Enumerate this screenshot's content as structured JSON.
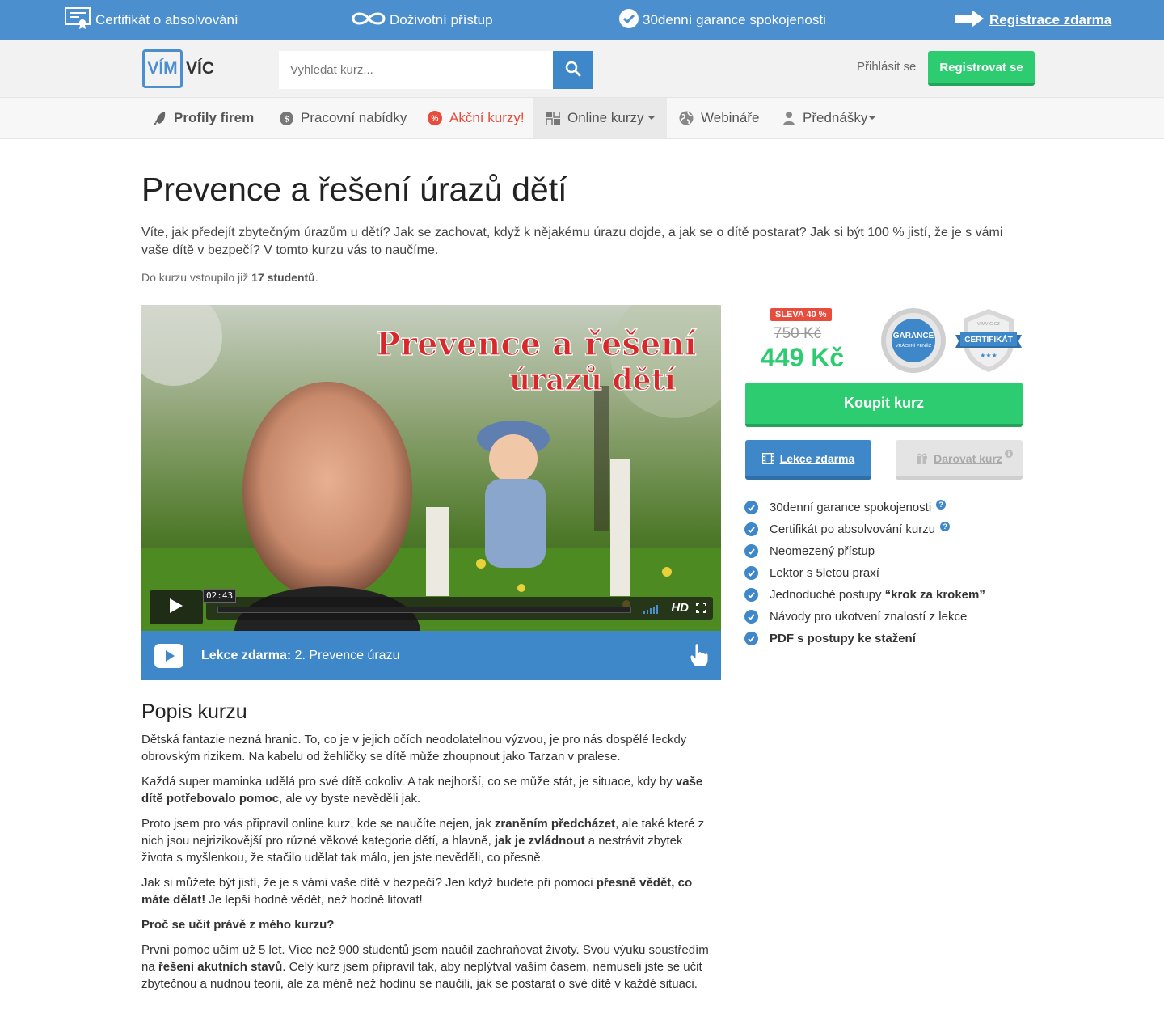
{
  "topbar": {
    "certificate": "Certifikát o absolvování",
    "lifetime": "Doživotní přístup",
    "guarantee": "30denní garance spokojenosti",
    "register": "Registrace zdarma"
  },
  "header": {
    "logo_left": "VÍM",
    "logo_right": "VÍC",
    "search_placeholder": "Vyhledat kurz...",
    "login": "Přihlásit se",
    "register": "Registrovat se"
  },
  "nav": {
    "items": [
      {
        "label": "Profily firem",
        "icon": "rocket-icon"
      },
      {
        "label": "Pracovní nabídky",
        "icon": "dollar-icon"
      },
      {
        "label": "Akční kurzy!",
        "icon": "percent-icon"
      },
      {
        "label": "Online kurzy",
        "icon": "grid-icon"
      },
      {
        "label": "Webináře",
        "icon": "globe-icon"
      },
      {
        "label": "Přednášky",
        "icon": "person-icon"
      }
    ]
  },
  "course": {
    "title": "Prevence a řešení úrazů dětí",
    "lead": "Víte, jak předejít zbytečným úrazům u dětí? Jak se zachovat, když k nějakému úrazu dojde, a jak se o dítě postarat? Jak si být 100 % jistí, že je s vámi vaše dítě v bezpečí? V tomto kurzu vás to naučíme.",
    "students_prefix": "Do kurzu vstoupilo již",
    "students_count": "17 studentů",
    "students_suffix": "."
  },
  "video": {
    "overlay_line1": "Prevence a řešení",
    "overlay_line2": "úrazů dětí",
    "timestamp": "02:43",
    "hd": "HD",
    "lesson_label": "Lekce zdarma:",
    "lesson_title": "2. Prevence úrazu"
  },
  "pricing": {
    "discount": "SLEVA 40 %",
    "old_price": "750 Kč",
    "new_price": "449 Kč",
    "badge_guarantee_line1": "GARANCE",
    "badge_guarantee_line2": "VRÁCENÍ PENĚZ",
    "badge_certificate": "CERTIFIKÁT",
    "badge_certificate_top": "VÍMVÍC.CZ",
    "buy": "Koupit kurz",
    "free_lesson": "Lekce zdarma",
    "gift": "Darovat kurz"
  },
  "features": [
    {
      "pre": "30denní garance spokojenosti",
      "bold": "",
      "help": true
    },
    {
      "pre": "Certifikát po absolvování kurzu",
      "bold": "",
      "help": true
    },
    {
      "pre": "Neomezený přístup",
      "bold": "",
      "help": false
    },
    {
      "pre": "Lektor s 5letou praxí",
      "bold": "",
      "help": false
    },
    {
      "pre": "Jednoduché postupy ",
      "bold": "“krok za krokem”",
      "help": false
    },
    {
      "pre": "Návody pro ukotvení znalostí z lekce",
      "bold": "",
      "help": false
    },
    {
      "pre": "",
      "bold": "PDF s postupy ke stažení",
      "help": false
    }
  ],
  "description": {
    "title": "Popis kurzu",
    "p1": "Dětská fantazie nezná hranic. To, co je v jejich očích neodolatelnou výzvou, je pro nás dospělé leckdy obrovským rizikem. Na kabelu od žehličky se dítě může zhoupnout jako Tarzan v pralese.",
    "p2a": "Každá super maminka udělá pro své dítě cokoliv. A tak nejhorší, co se může stát, je situace, kdy by ",
    "p2b": "vaše dítě potřebovalo pomoc",
    "p2c": ", ale vy byste nevěděli jak.",
    "p3a": "Proto jsem pro vás připravil online kurz, kde se naučíte nejen, jak ",
    "p3b": "zraněním předcházet",
    "p3c": ", ale také které z nich jsou nejrizikovější pro různé věkové kategorie dětí, a hlavně, ",
    "p3d": "jak je zvládnout",
    "p3e": " a nestrávit zbytek života s myšlenkou, že stačilo udělat tak málo, jen jste nevěděli, co přesně.",
    "p4a": "Jak si můžete být jistí, že je s vámi vaše dítě v bezpečí? Jen když budete při pomoci ",
    "p4b": "přesně vědět, co máte dělat!",
    "p4c": " Je lepší hodně vědět, než hodně litovat!",
    "p5": "Proč se učit právě z mého kurzu?",
    "p6a": "První pomoc učím už 5 let. Více než 900 studentů jsem naučil zachraňovat životy. Svou výuku soustředím na ",
    "p6b": "řešení akutních stavů",
    "p6c": ". Celý kurz jsem připravil tak, aby neplýtval vaším časem, nemuseli jste se učit zbytečnou a nudnou teorii, ale za méně než hodinu se naučili, jak se postarat o své dítě v každé situaci."
  }
}
